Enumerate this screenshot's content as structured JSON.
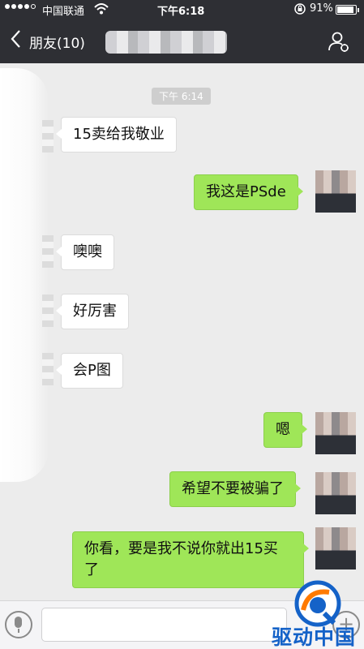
{
  "status_bar": {
    "carrier": "中国联通",
    "time": "下午6:18",
    "battery": "91%",
    "battery_level": 0.91
  },
  "nav": {
    "back_label": "朋友(10)"
  },
  "chat": {
    "timestamp": "下午 6:14",
    "messages": [
      {
        "dir": "in",
        "text": "15卖给我敬业"
      },
      {
        "dir": "out",
        "text": "我这是PSde"
      },
      {
        "dir": "in",
        "text": "噢噢"
      },
      {
        "dir": "in",
        "text": "好厉害"
      },
      {
        "dir": "in",
        "text": "会P图"
      },
      {
        "dir": "out",
        "text": "嗯"
      },
      {
        "dir": "out",
        "text": "希望不要被骗了"
      },
      {
        "dir": "out",
        "text": "你看，要是我不说你就出15买了"
      }
    ]
  },
  "watermark": {
    "text": "驱动中国"
  },
  "colors": {
    "nav_bg": "#2e2f34",
    "chat_bg": "#ececec",
    "out_bubble": "#9fe658",
    "in_bubble": "#ffffff",
    "watermark": "#1462c8"
  },
  "icons": [
    "chevron-left-icon",
    "person-icon",
    "voice-icon",
    "plus-icon",
    "wifi-icon",
    "lock-rotation-icon"
  ]
}
